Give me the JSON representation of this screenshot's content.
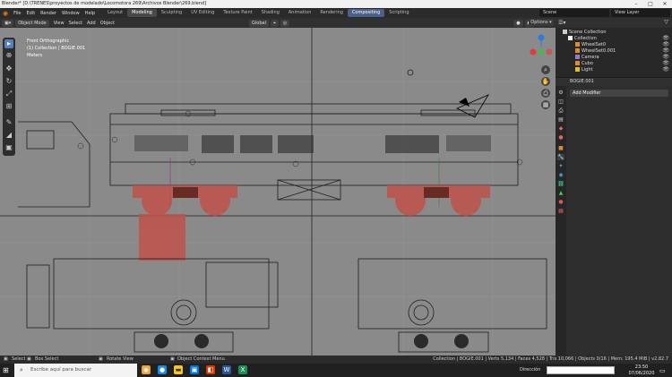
{
  "window": {
    "title": "Blender* [D:\\TRENES\\proyectos de modelado\\Locomotora 269\\Archivos Blender\\269.blend]",
    "min": "–",
    "max": "□",
    "close": "✕"
  },
  "menu": [
    "File",
    "Edit",
    "Render",
    "Window",
    "Help"
  ],
  "workspace_tabs": [
    "Layout",
    "Modeling",
    "Sculpting",
    "UV Editing",
    "Texture Paint",
    "Shading",
    "Animation",
    "Rendering",
    "Compositing",
    "Scripting"
  ],
  "workspace_active": "Modeling",
  "scene": "Scene",
  "view_layer": "View Layer",
  "viewport_header": {
    "mode": "Object Mode",
    "menus": [
      "View",
      "Select",
      "Add",
      "Object"
    ],
    "orientation": "Global",
    "options": "Options ▾"
  },
  "viewport_info": {
    "view": "Front Orthographic",
    "collection": "(1) Collection | BOGIE.001",
    "units": "Meters"
  },
  "outliner": {
    "root": "Scene Collection",
    "collection": "Collection",
    "items": [
      {
        "name": "WheelSet0",
        "color": "#e08a2d"
      },
      {
        "name": "WheelSet0.001",
        "color": "#e08a2d"
      },
      {
        "name": "Camera",
        "color": "#8c7bd0"
      },
      {
        "name": "Cubo",
        "color": "#e08a2d"
      },
      {
        "name": "Light",
        "color": "#e0c02d"
      }
    ]
  },
  "properties": {
    "object": "BOGIE.001",
    "add_modifier": "Add Modifier"
  },
  "status": {
    "select": "Select",
    "box_select": "Box Select",
    "rotate_view": "Rotate View",
    "context_menu": "Object Context Menu",
    "stats": "Collection | BOGIE.001 | Verts 5,134 | Faces 4,528 | Tris 10,066 | Objects 0/16 | Mem: 195.4 MiB | v2.82.7"
  },
  "taskbar": {
    "search_placeholder": "Escribe aquí para buscar",
    "address_label": "Dirección",
    "time": "23:50",
    "date": "07/06/2020"
  },
  "colors": {
    "accent": "#5680c2",
    "selection_red": "#c0524a",
    "viewport_bg": "#8a8a8a"
  }
}
